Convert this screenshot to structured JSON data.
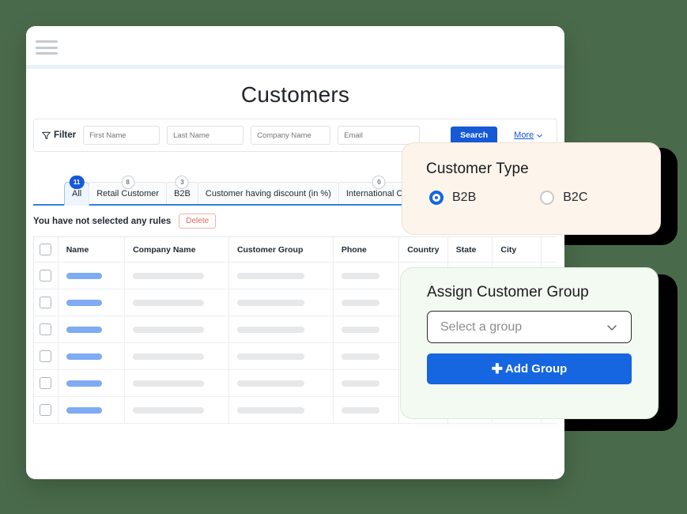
{
  "window": {
    "menu_icon": "hamburger-menu-icon",
    "page_title": "Customers"
  },
  "filter": {
    "label": "Filter",
    "icon": "funnel-icon",
    "fields": [
      {
        "name": "first-name",
        "placeholder": "First Name",
        "value": ""
      },
      {
        "name": "last-name",
        "placeholder": "Last Name",
        "value": ""
      },
      {
        "name": "company-name",
        "placeholder": "Company Name",
        "value": ""
      },
      {
        "name": "email",
        "placeholder": "Email",
        "value": ""
      }
    ],
    "search_label": "Search",
    "more_label": "More",
    "more_icon": "chevron-down-icon"
  },
  "tabs": [
    {
      "label": "All",
      "badge": "11",
      "active": true
    },
    {
      "label": "Retail Customer",
      "badge": "8",
      "active": false
    },
    {
      "label": "B2B",
      "badge": "3",
      "active": false
    },
    {
      "label": "Customer having discount (in %)",
      "badge": "",
      "active": false
    },
    {
      "label": "International Cus",
      "badge": "0",
      "active": false
    }
  ],
  "rules": {
    "message": "You have not selected any  rules",
    "delete_label": "Delete"
  },
  "table": {
    "columns": [
      "Name",
      "Company  Name",
      "Customer Group",
      "Phone",
      "Country",
      "State",
      "City"
    ],
    "row_count": 6,
    "select_all_checkbox": "unchecked"
  },
  "customer_type_card": {
    "title": "Customer Type",
    "options": [
      {
        "label": "B2B",
        "selected": true
      },
      {
        "label": "B2C",
        "selected": false
      }
    ]
  },
  "assign_group_card": {
    "title": "Assign Customer Group",
    "select_placeholder": "Select a group",
    "select_icon": "chevron-down-icon",
    "add_button_label": "Add Group",
    "add_button_icon": "plus-icon"
  },
  "colors": {
    "page_background": "#4a6b4b",
    "primary_blue": "#1566e0",
    "tab_accent": "#2f7fe0",
    "delete_red": "#ef5f5f",
    "card_cream": "#fdf4ec",
    "card_mint": "#f2faf1",
    "placeholder_gray": "#e6e8ea",
    "placeholder_blue": "#7fabf2"
  }
}
